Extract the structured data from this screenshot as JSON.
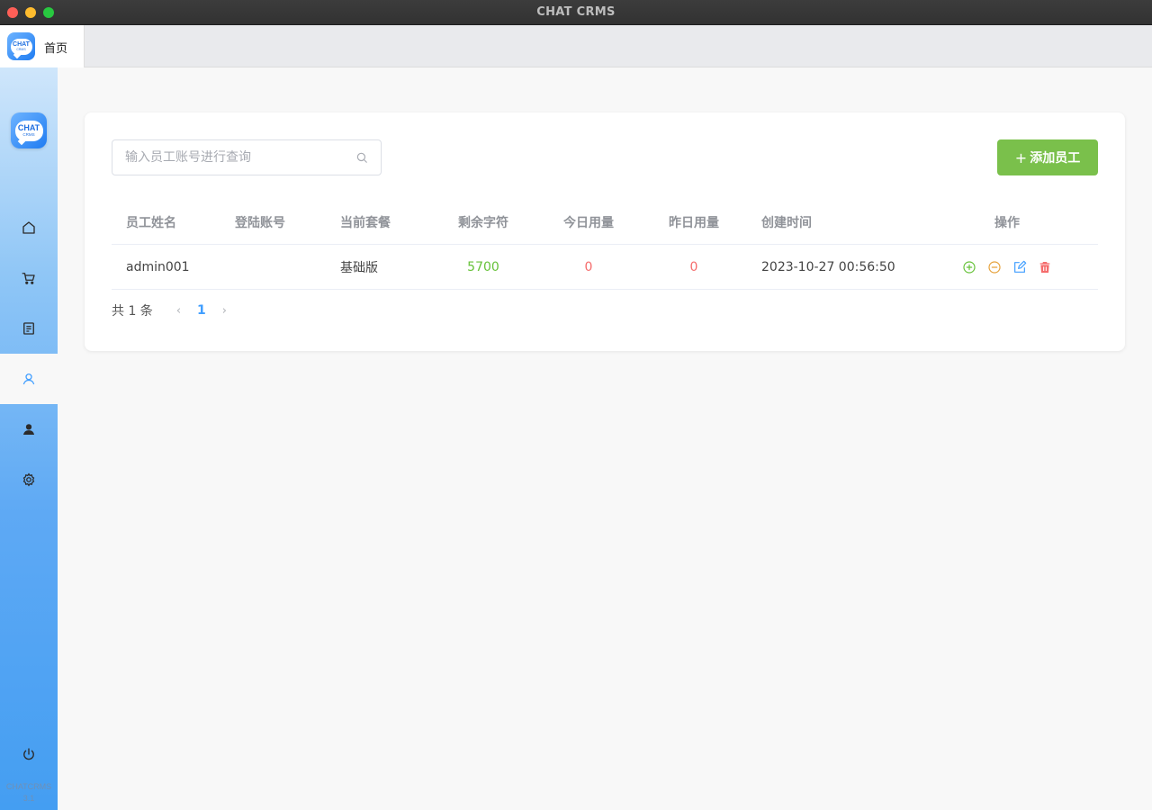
{
  "window": {
    "title": "CHAT CRMS"
  },
  "logo": {
    "line1": "CHAT",
    "line2": "CRMS"
  },
  "tabs": [
    {
      "label": "首页"
    }
  ],
  "sidebar": {
    "items": [
      {
        "icon": "home-icon"
      },
      {
        "icon": "cart-icon"
      },
      {
        "icon": "document-icon"
      },
      {
        "icon": "user-outline-icon",
        "active": true
      },
      {
        "icon": "user-filled-icon"
      },
      {
        "icon": "gear-icon"
      }
    ],
    "power_icon": "power-icon",
    "app_name": "CHATCRMS",
    "version": "3.1"
  },
  "toolbar": {
    "search_placeholder": "输入员工账号进行查询",
    "add_button_plus": "+",
    "add_button_label": "添加员工"
  },
  "table": {
    "headers": [
      "员工姓名",
      "登陆账号",
      "当前套餐",
      "剩余字符",
      "今日用量",
      "昨日用量",
      "创建时间",
      "操作"
    ],
    "rows": [
      {
        "name": "admin001",
        "account": "",
        "plan": "基础版",
        "remaining": "5700",
        "today": "0",
        "yesterday": "0",
        "created": "2023-10-27 00:56:50"
      }
    ],
    "actions": [
      "add-circle-icon",
      "minus-circle-icon",
      "edit-icon",
      "delete-icon"
    ]
  },
  "pagination": {
    "total_text": "共 1 条",
    "prev": "‹",
    "current_page": "1",
    "next": "›"
  },
  "colors": {
    "accent": "#409eff",
    "add_button": "#7ac04b",
    "positive": "#67c23a",
    "negative": "#f56c6c",
    "sidebar_top": "#cfe6fb",
    "sidebar_bottom": "#449ef2"
  }
}
